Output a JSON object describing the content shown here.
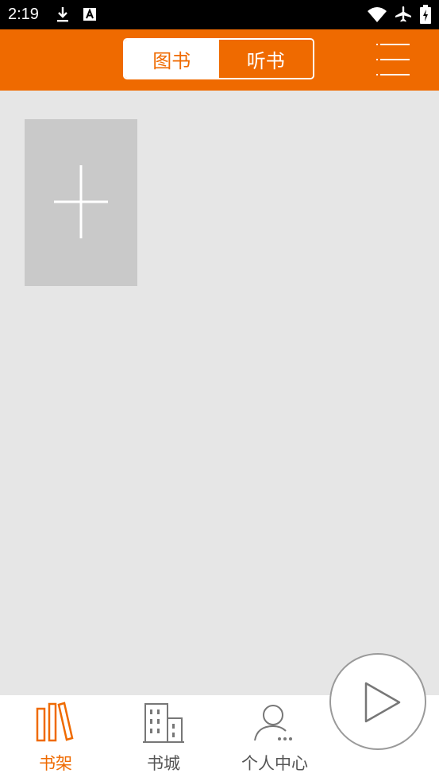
{
  "status_bar": {
    "time": "2:19",
    "icons": [
      "download-icon",
      "keyboard-a-icon",
      "wifi-icon",
      "airplane-icon",
      "battery-charging-icon"
    ]
  },
  "header": {
    "tabs": [
      {
        "label": "图书",
        "active": true
      },
      {
        "label": "听书",
        "active": false
      }
    ],
    "menu_icon": "menu-icon"
  },
  "shelf": {
    "add_icon": "plus-icon"
  },
  "bottom_nav": {
    "items": [
      {
        "label": "书架",
        "icon": "bookshelf-icon",
        "active": true
      },
      {
        "label": "书城",
        "icon": "building-icon",
        "active": false
      },
      {
        "label": "个人中心",
        "icon": "user-icon",
        "active": false
      }
    ]
  },
  "play_button_icon": "play-icon",
  "colors": {
    "accent": "#ef6a00",
    "background": "#e6e6e6",
    "tile": "#c9c9c9"
  }
}
